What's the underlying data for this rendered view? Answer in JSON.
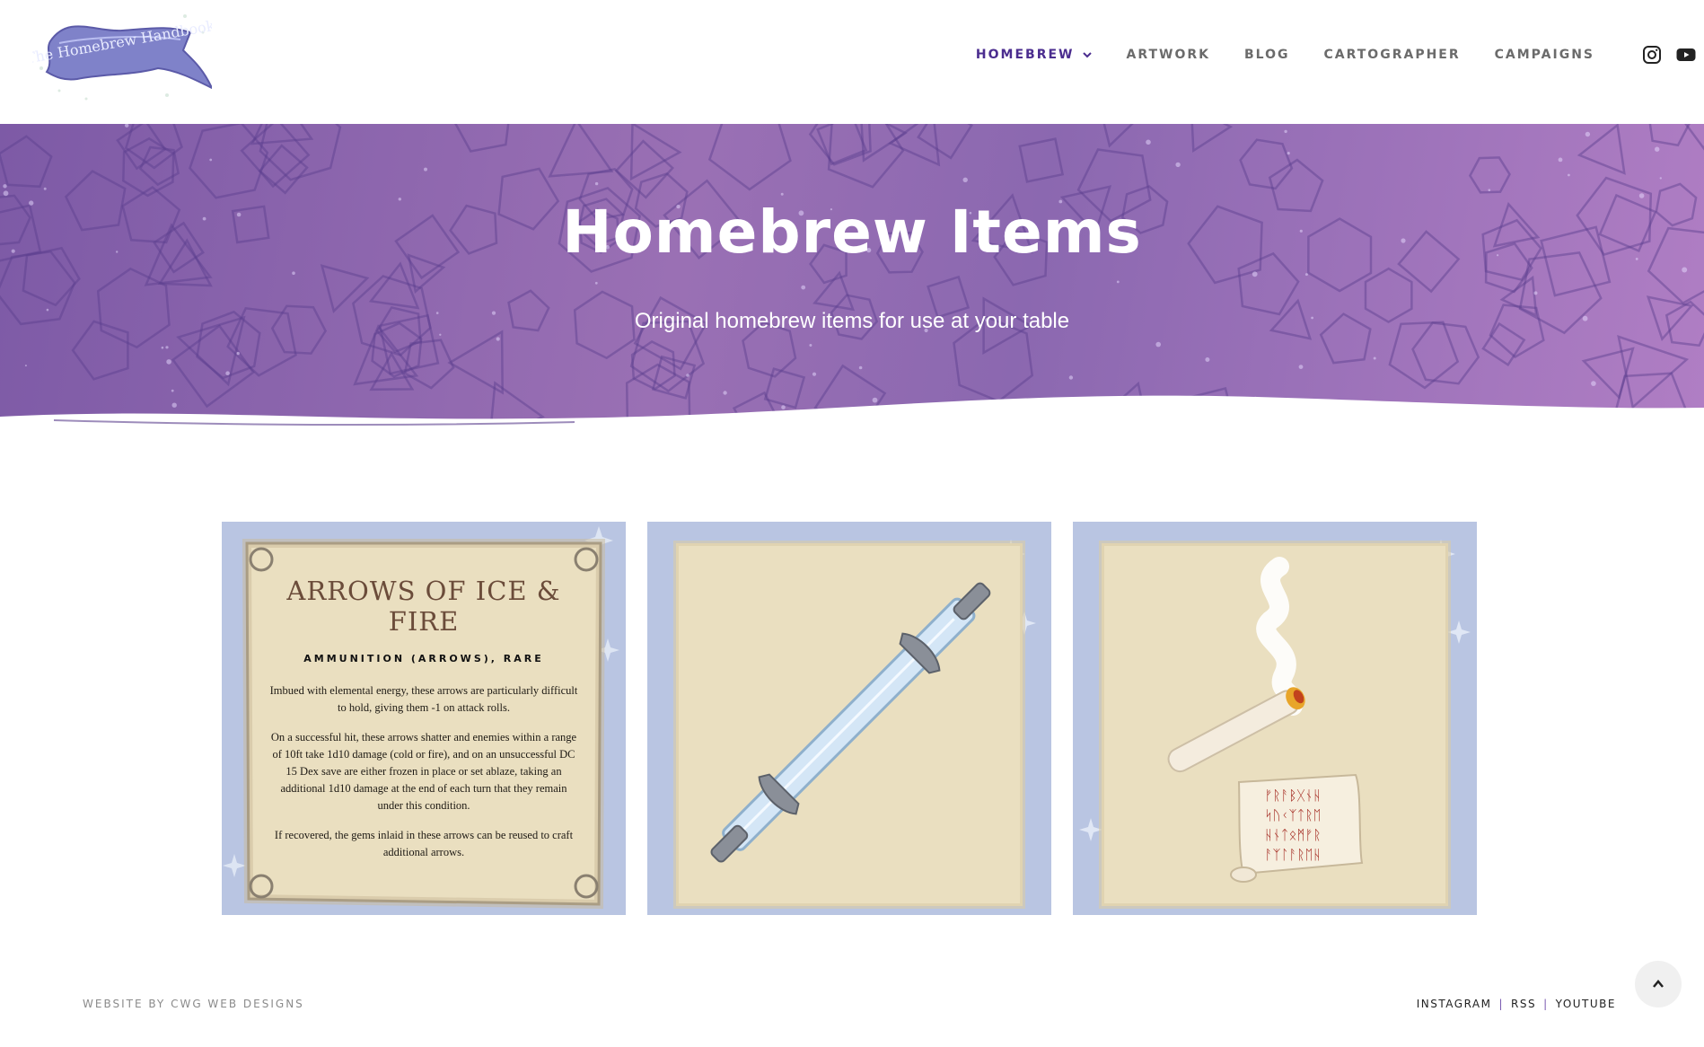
{
  "header": {
    "logo_text": "The Homebrew Handbook",
    "nav": [
      {
        "label": "HOMEBREW",
        "active": true,
        "has_dropdown": true
      },
      {
        "label": "ARTWORK"
      },
      {
        "label": "BLOG"
      },
      {
        "label": "CARTOGRAPHER"
      },
      {
        "label": "CAMPAIGNS"
      }
    ],
    "social_icons": [
      "instagram-icon",
      "youtube-icon"
    ]
  },
  "hero": {
    "title": "Homebrew Items",
    "subtitle": "Original homebrew items for use at your table"
  },
  "cards": [
    {
      "name": "arrows-of-ice-and-fire",
      "title": "ARROWS OF ICE & FIRE",
      "type": "AMMUNITION (ARROWS), RARE",
      "paragraphs": [
        "Imbued with elemental energy, these arrows are particularly difficult to hold, giving them -1 on attack rolls.",
        "On a successful hit, these arrows shatter and enemies within a range of 10ft take 1d10 damage (cold or fire), and on an unsuccessful DC 15 Dex save are either frozen in place or set ablaze, taking an additional 1d10 damage at the end of each turn that they remain under this condition.",
        "If recovered, the gems inlaid in these arrows can be reused to craft additional arrows."
      ]
    },
    {
      "name": "double-bladed-sword",
      "image": "ice-sword"
    },
    {
      "name": "scroll-and-candle",
      "image": "smoking-roll-and-rune-scroll",
      "runes": [
        "ᚠᚱᚨᛒᚷᚾᚺ",
        "ᛋᚢᚲᛉᛏᚱᛖ",
        "ᚺᚾᛏᛟᛗᚠᚱ",
        "ᚨᛉᛚᚨᚱᛖᚺ"
      ]
    }
  ],
  "footer": {
    "credit": "WEBSITE BY CWG WEB DESIGNS",
    "links": [
      "INSTAGRAM",
      "RSS",
      "YOUTUBE"
    ],
    "separator": "|"
  },
  "colors": {
    "accent": "#4b2d8f",
    "hero_gradient_start": "#7d5aa6",
    "hero_gradient_end": "#b07ec4",
    "card_bg": "#b9c5e2",
    "parchment": "#eadfc0"
  }
}
